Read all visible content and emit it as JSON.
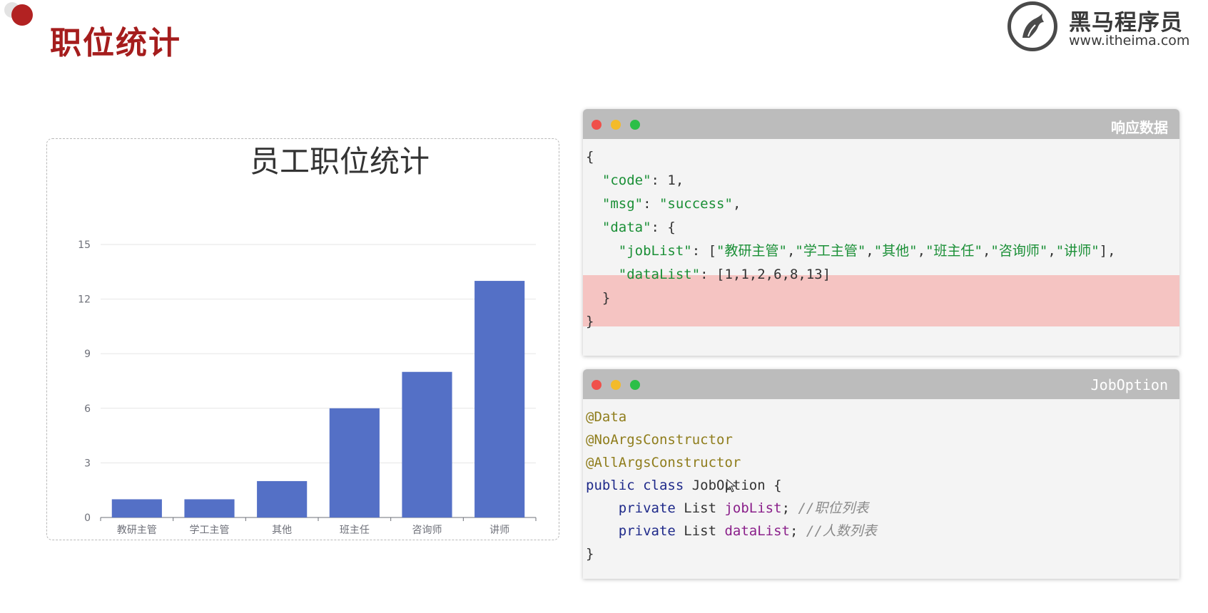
{
  "page": {
    "title": "职位统计"
  },
  "logo": {
    "name": "黑马程序员",
    "url": "www.itheima.com"
  },
  "chart_data": {
    "type": "bar",
    "title": "员工职位统计",
    "categories": [
      "教研主管",
      "学工主管",
      "其他",
      "班主任",
      "咨询师",
      "讲师"
    ],
    "values": [
      1,
      1,
      2,
      6,
      8,
      13
    ],
    "ylim": [
      0,
      15
    ],
    "yticks": [
      "0",
      "3",
      "6",
      "9",
      "12",
      "15"
    ],
    "grid": true,
    "bar_color": "#5470c6"
  },
  "response_window": {
    "title": "响应数据",
    "lines": [
      "{",
      "  \"code\": 1,",
      "  \"msg\": \"success\",",
      "  \"data\": {",
      "    \"jobList\": [\"教研主管\",\"学工主管\",\"其他\",\"班主任\",\"咨询师\",\"讲师\"],",
      "    \"dataList\": [1,1,2,6,8,13]",
      "  }",
      "}"
    ]
  },
  "class_window": {
    "title": "JobOption",
    "lines": [
      "@Data",
      "@NoArgsConstructor",
      "@AllArgsConstructor",
      "public class JobOption {",
      "    private List jobList; //职位列表",
      "    private List dataList; //人数列表",
      "}"
    ]
  },
  "colors": {
    "title_red": "#a51d1d",
    "bar_blue": "#5470c6",
    "highlight": "#f5c4c2",
    "json_key_green": "#1a8f36",
    "annotation": "#8f7d1c"
  }
}
